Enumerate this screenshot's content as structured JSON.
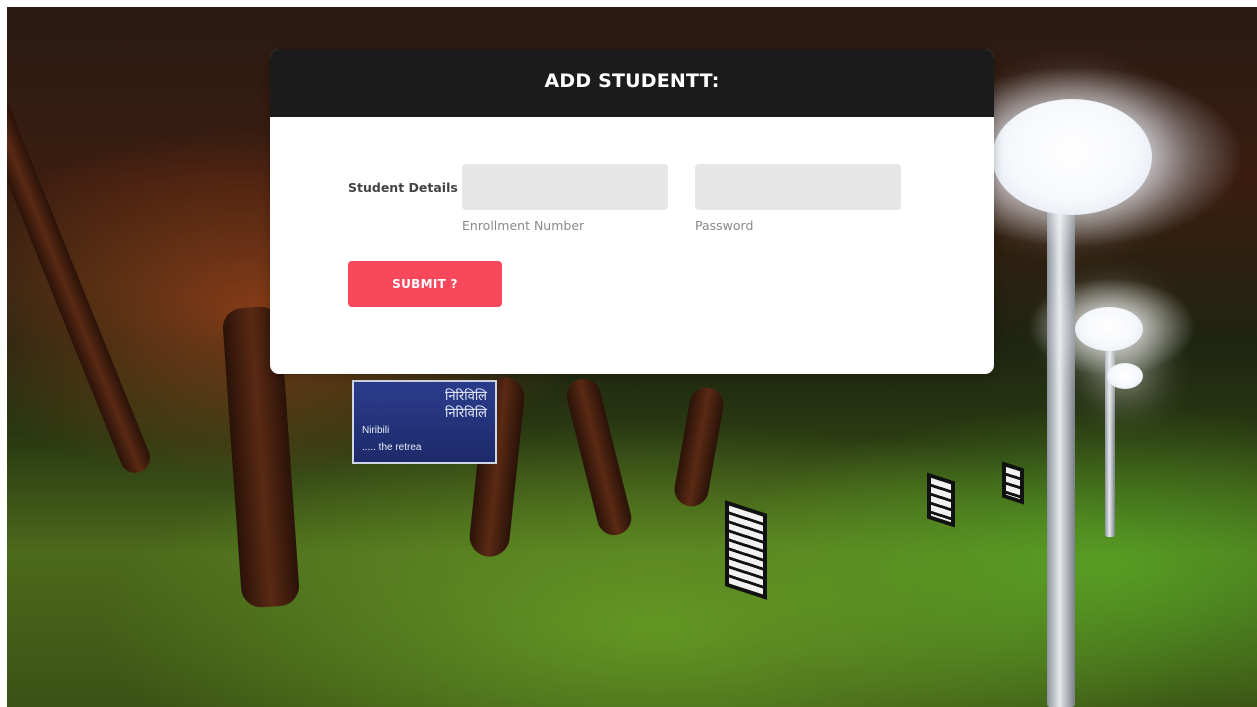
{
  "page": {
    "background": "night-park-photo"
  },
  "scene": {
    "signboard": {
      "line1": "निरिविलि",
      "line2": "निरिविलि",
      "line3": "Niribili",
      "line4": "..... the retrea"
    }
  },
  "card": {
    "title": "ADD STUDENTT:",
    "header_color": "#1b1b1b",
    "row_label": "Student Details",
    "enrollment": {
      "value": "",
      "placeholder": "",
      "hint": "Enrollment Number"
    },
    "password": {
      "value": "",
      "placeholder": "",
      "hint": "Password"
    },
    "submit_label": "SUBMIT ?",
    "submit_color": "#f9475b"
  }
}
